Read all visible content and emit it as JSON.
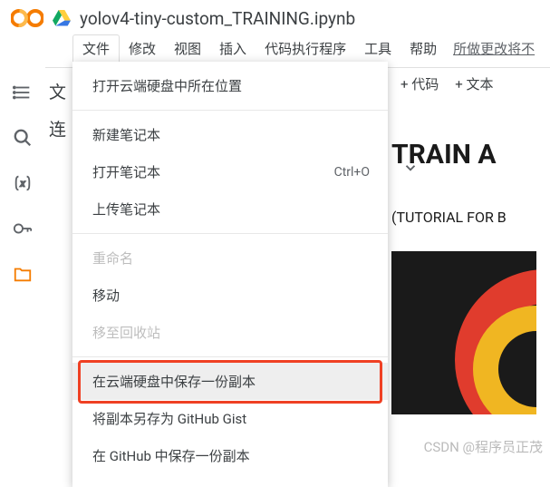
{
  "header": {
    "doc_title": "yolov4-tiny-custom_TRAINING.ipynb"
  },
  "menubar": {
    "items": [
      "文件",
      "修改",
      "视图",
      "插入",
      "代码执行程序",
      "工具",
      "帮助"
    ],
    "status_link": "所做更改将不"
  },
  "toolbar": {
    "code_btn": "+ 代码",
    "text_btn": "+ 文本"
  },
  "sidebar": {
    "section1": "文",
    "section2": "连"
  },
  "dropdown": {
    "items": [
      {
        "label": "打开云端硬盘中所在位置",
        "enabled": true
      },
      {
        "label": "新建笔记本",
        "enabled": true
      },
      {
        "label": "打开笔记本",
        "enabled": true,
        "shortcut": "Ctrl+O"
      },
      {
        "label": "上传笔记本",
        "enabled": true
      },
      {
        "label": "重命名",
        "enabled": false
      },
      {
        "label": "移动",
        "enabled": true
      },
      {
        "label": "移至回收站",
        "enabled": false
      },
      {
        "label": "在云端硬盘中保存一份副本",
        "enabled": true,
        "highlighted": true
      },
      {
        "label": "将副本另存为 GitHub Gist",
        "enabled": true
      },
      {
        "label": "在 GitHub 中保存一份副本",
        "enabled": true
      }
    ]
  },
  "content": {
    "heading": "TRAIN A",
    "subheading": "(TUTORIAL FOR B"
  },
  "watermark": "CSDN @程序员正茂"
}
